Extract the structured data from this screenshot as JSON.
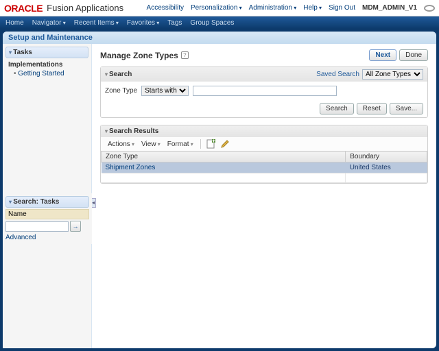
{
  "topbar": {
    "brand1": "ORACLE",
    "brand2": "Fusion Applications",
    "links": {
      "accessibility": "Accessibility",
      "personalization": "Personalization",
      "administration": "Administration",
      "help": "Help",
      "signout": "Sign Out",
      "user": "MDM_ADMIN_V1"
    }
  },
  "navbar": {
    "home": "Home",
    "navigator": "Navigator",
    "recent": "Recent Items",
    "favorites": "Favorites",
    "tags": "Tags",
    "spaces": "Group Spaces"
  },
  "setup_header": "Setup and Maintenance",
  "sidebar": {
    "tasks_hdr": "Tasks",
    "group": "Implementations",
    "link": "Getting Started"
  },
  "search_tasks": {
    "hdr": "Search: Tasks",
    "name_label": "Name",
    "advanced": "Advanced"
  },
  "main": {
    "title": "Manage Zone Types",
    "next": "Next",
    "done": "Done"
  },
  "search_panel": {
    "hdr": "Search",
    "saved_label": "Saved Search",
    "saved_value": "All Zone Types",
    "field_label": "Zone Type",
    "operator": "Starts with",
    "btn_search": "Search",
    "btn_reset": "Reset",
    "btn_save": "Save..."
  },
  "results": {
    "hdr": "Search Results",
    "menus": {
      "actions": "Actions",
      "view": "View",
      "format": "Format"
    },
    "col1": "Zone Type",
    "col2": "Boundary",
    "row": {
      "type": "Shipment Zones",
      "boundary": "United States"
    }
  }
}
